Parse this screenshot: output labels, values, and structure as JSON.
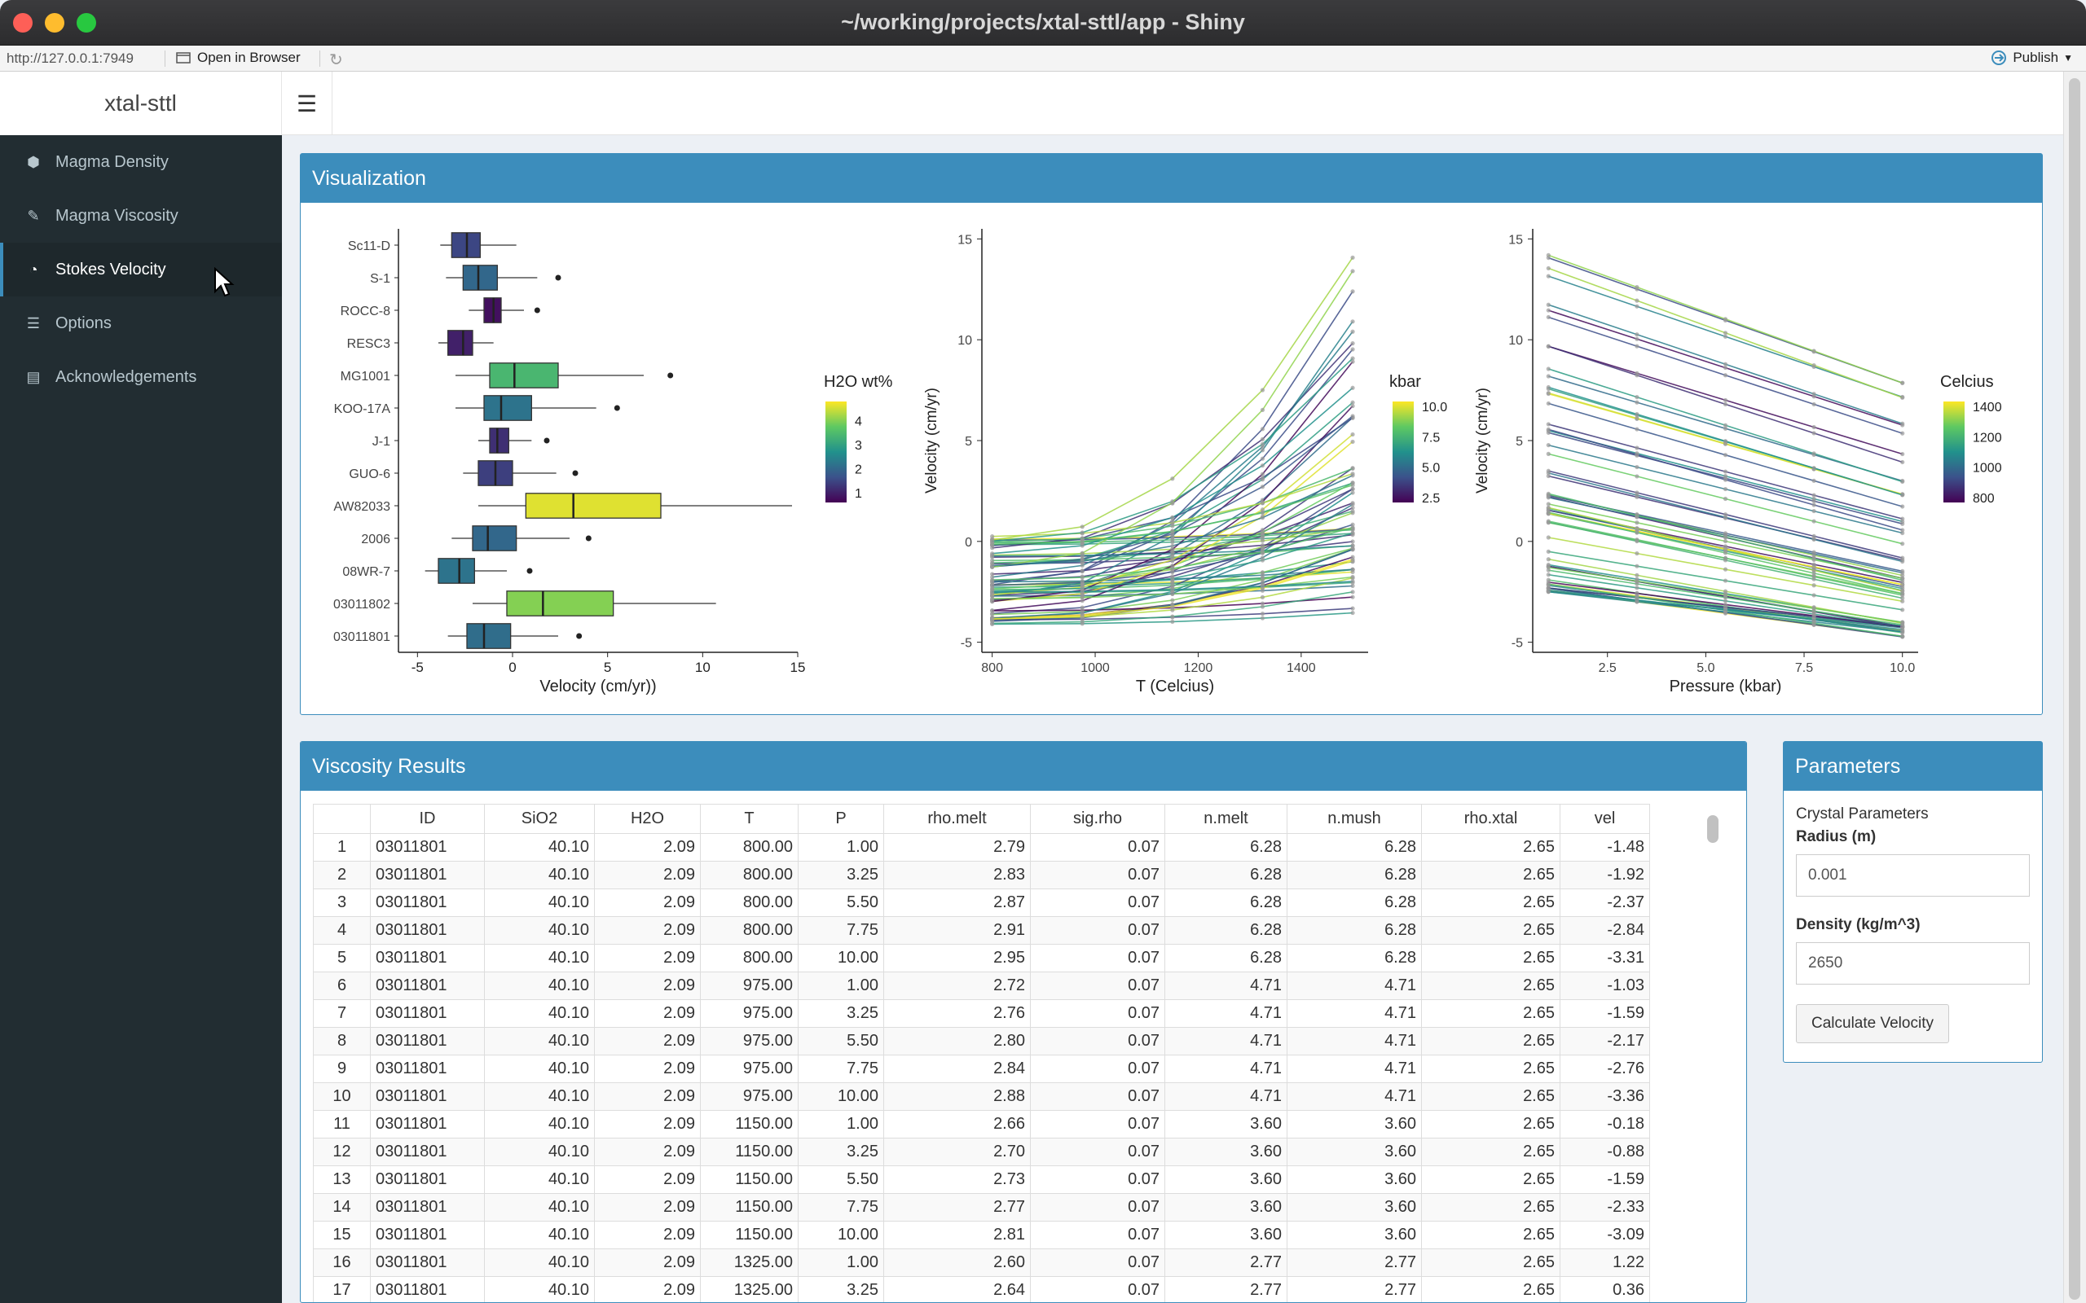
{
  "window": {
    "title": "~/working/projects/xtal-sttl/app - Shiny"
  },
  "addressbar": {
    "url": "http://127.0.0.1:7949",
    "open_label": "Open in Browser",
    "publish_label": "Publish"
  },
  "brand": "xtal-sttl",
  "sidebar": {
    "items": [
      {
        "label": "Magma Density",
        "icon": "cube-icon"
      },
      {
        "label": "Magma Viscosity",
        "icon": "dropper-icon"
      },
      {
        "label": "Stokes Velocity",
        "icon": "dashboard-icon",
        "active": true
      },
      {
        "label": "Options",
        "icon": "sliders-icon"
      },
      {
        "label": "Acknowledgements",
        "icon": "book-icon"
      }
    ]
  },
  "viz": {
    "title": "Visualization"
  },
  "results": {
    "title": "Viscosity Results",
    "columns": [
      "",
      "ID",
      "SiO2",
      "H2O",
      "T",
      "P",
      "rho.melt",
      "sig.rho",
      "n.melt",
      "n.mush",
      "rho.xtal",
      "vel"
    ],
    "rows": [
      [
        "1",
        "03011801",
        "40.10",
        "2.09",
        "800.00",
        "1.00",
        "2.79",
        "0.07",
        "6.28",
        "6.28",
        "2.65",
        "-1.48"
      ],
      [
        "2",
        "03011801",
        "40.10",
        "2.09",
        "800.00",
        "3.25",
        "2.83",
        "0.07",
        "6.28",
        "6.28",
        "2.65",
        "-1.92"
      ],
      [
        "3",
        "03011801",
        "40.10",
        "2.09",
        "800.00",
        "5.50",
        "2.87",
        "0.07",
        "6.28",
        "6.28",
        "2.65",
        "-2.37"
      ],
      [
        "4",
        "03011801",
        "40.10",
        "2.09",
        "800.00",
        "7.75",
        "2.91",
        "0.07",
        "6.28",
        "6.28",
        "2.65",
        "-2.84"
      ],
      [
        "5",
        "03011801",
        "40.10",
        "2.09",
        "800.00",
        "10.00",
        "2.95",
        "0.07",
        "6.28",
        "6.28",
        "2.65",
        "-3.31"
      ],
      [
        "6",
        "03011801",
        "40.10",
        "2.09",
        "975.00",
        "1.00",
        "2.72",
        "0.07",
        "4.71",
        "4.71",
        "2.65",
        "-1.03"
      ],
      [
        "7",
        "03011801",
        "40.10",
        "2.09",
        "975.00",
        "3.25",
        "2.76",
        "0.07",
        "4.71",
        "4.71",
        "2.65",
        "-1.59"
      ],
      [
        "8",
        "03011801",
        "40.10",
        "2.09",
        "975.00",
        "5.50",
        "2.80",
        "0.07",
        "4.71",
        "4.71",
        "2.65",
        "-2.17"
      ],
      [
        "9",
        "03011801",
        "40.10",
        "2.09",
        "975.00",
        "7.75",
        "2.84",
        "0.07",
        "4.71",
        "4.71",
        "2.65",
        "-2.76"
      ],
      [
        "10",
        "03011801",
        "40.10",
        "2.09",
        "975.00",
        "10.00",
        "2.88",
        "0.07",
        "4.71",
        "4.71",
        "2.65",
        "-3.36"
      ],
      [
        "11",
        "03011801",
        "40.10",
        "2.09",
        "1150.00",
        "1.00",
        "2.66",
        "0.07",
        "3.60",
        "3.60",
        "2.65",
        "-0.18"
      ],
      [
        "12",
        "03011801",
        "40.10",
        "2.09",
        "1150.00",
        "3.25",
        "2.70",
        "0.07",
        "3.60",
        "3.60",
        "2.65",
        "-0.88"
      ],
      [
        "13",
        "03011801",
        "40.10",
        "2.09",
        "1150.00",
        "5.50",
        "2.73",
        "0.07",
        "3.60",
        "3.60",
        "2.65",
        "-1.59"
      ],
      [
        "14",
        "03011801",
        "40.10",
        "2.09",
        "1150.00",
        "7.75",
        "2.77",
        "0.07",
        "3.60",
        "3.60",
        "2.65",
        "-2.33"
      ],
      [
        "15",
        "03011801",
        "40.10",
        "2.09",
        "1150.00",
        "10.00",
        "2.81",
        "0.07",
        "3.60",
        "3.60",
        "2.65",
        "-3.09"
      ],
      [
        "16",
        "03011801",
        "40.10",
        "2.09",
        "1325.00",
        "1.00",
        "2.60",
        "0.07",
        "2.77",
        "2.77",
        "2.65",
        "1.22"
      ],
      [
        "17",
        "03011801",
        "40.10",
        "2.09",
        "1325.00",
        "3.25",
        "2.64",
        "0.07",
        "2.77",
        "2.77",
        "2.65",
        "0.36"
      ]
    ]
  },
  "params": {
    "title": "Parameters",
    "subtitle": "Crystal Parameters",
    "radius_label": "Radius (m)",
    "radius_value": "0.001",
    "density_label": "Density (kg/m^3)",
    "density_value": "2650",
    "button_label": "Calculate Velocity"
  },
  "chart_data": [
    {
      "type": "box",
      "xlabel": "Velocity (cm/yr))",
      "ylabel": "",
      "xlim": [
        -6,
        15
      ],
      "xticks": [
        -5,
        0,
        5,
        10,
        15
      ],
      "legend_title": "H2O wt%",
      "legend_ticks": [
        4,
        3,
        2,
        1
      ],
      "categories": [
        "Sc11-D",
        "S-1",
        "ROCC-8",
        "RESC3",
        "MG1001",
        "KOO-17A",
        "J-1",
        "GUO-6",
        "AW82033",
        "2006",
        "08WR-7",
        "03011802",
        "03011801"
      ],
      "boxes": [
        {
          "min": -3.8,
          "q1": -3.2,
          "median": -2.4,
          "q3": -1.7,
          "max": 0.2,
          "outliers": [],
          "h2o": 1.5
        },
        {
          "min": -3.5,
          "q1": -2.6,
          "median": -1.8,
          "q3": -0.8,
          "max": 1.3,
          "outliers": [
            2.4
          ],
          "h2o": 2.0
        },
        {
          "min": -2.3,
          "q1": -1.5,
          "median": -1.0,
          "q3": -0.6,
          "max": 0.6,
          "outliers": [
            1.3
          ],
          "h2o": 0.8
        },
        {
          "min": -3.9,
          "q1": -3.4,
          "median": -2.6,
          "q3": -2.1,
          "max": -1.0,
          "outliers": [],
          "h2o": 1.0
        },
        {
          "min": -3.0,
          "q1": -1.2,
          "median": 0.1,
          "q3": 2.4,
          "max": 6.9,
          "outliers": [
            8.3
          ],
          "h2o": 3.4
        },
        {
          "min": -3.0,
          "q1": -1.5,
          "median": -0.6,
          "q3": 1.0,
          "max": 4.4,
          "outliers": [
            5.5
          ],
          "h2o": 2.2
        },
        {
          "min": -1.8,
          "q1": -1.2,
          "median": -0.8,
          "q3": -0.2,
          "max": 1.0,
          "outliers": [
            1.8
          ],
          "h2o": 1.2
        },
        {
          "min": -2.6,
          "q1": -1.8,
          "median": -0.9,
          "q3": 0.0,
          "max": 2.3,
          "outliers": [
            3.3
          ],
          "h2o": 1.4
        },
        {
          "min": -1.8,
          "q1": 0.7,
          "median": 3.2,
          "q3": 7.8,
          "max": 14.7,
          "outliers": [],
          "h2o": 4.6
        },
        {
          "min": -3.2,
          "q1": -2.1,
          "median": -1.3,
          "q3": 0.2,
          "max": 3.0,
          "outliers": [
            4.0
          ],
          "h2o": 2.0
        },
        {
          "min": -4.6,
          "q1": -3.9,
          "median": -2.8,
          "q3": -2.0,
          "max": -0.3,
          "outliers": [
            0.9
          ],
          "h2o": 2.2
        },
        {
          "min": -2.1,
          "q1": -0.3,
          "median": 1.6,
          "q3": 5.3,
          "max": 10.7,
          "outliers": [],
          "h2o": 4.0
        },
        {
          "min": -3.4,
          "q1": -2.4,
          "median": -1.5,
          "q3": -0.1,
          "max": 2.4,
          "outliers": [
            3.5
          ],
          "h2o": 2.1
        }
      ]
    },
    {
      "type": "line",
      "xlabel": "T (Celcius)",
      "ylabel": "Velocity (cm/yr)",
      "x": [
        800,
        975,
        1150,
        1325,
        1500
      ],
      "xlim": [
        780,
        1530
      ],
      "ylim": [
        -5.5,
        15.5
      ],
      "xticks": [
        800,
        1000,
        1200,
        1400
      ],
      "yticks": [
        -5,
        0,
        5,
        10,
        15
      ],
      "legend_title": "kbar",
      "legend_ticks": [
        10.0,
        7.5,
        5.0,
        2.5
      ],
      "series_count": 65
    },
    {
      "type": "line",
      "xlabel": "Pressure (kbar)",
      "ylabel": "Velocity (cm/yr)",
      "x": [
        1.0,
        3.25,
        5.5,
        7.75,
        10.0
      ],
      "xlim": [
        0.6,
        10.4
      ],
      "ylim": [
        -5.5,
        15.5
      ],
      "xticks": [
        2.5,
        5.0,
        7.5,
        10.0
      ],
      "yticks": [
        -5,
        0,
        5,
        10,
        15
      ],
      "legend_title": "Celcius",
      "legend_ticks": [
        1400,
        1200,
        1000,
        800
      ],
      "series_count": 65
    }
  ]
}
